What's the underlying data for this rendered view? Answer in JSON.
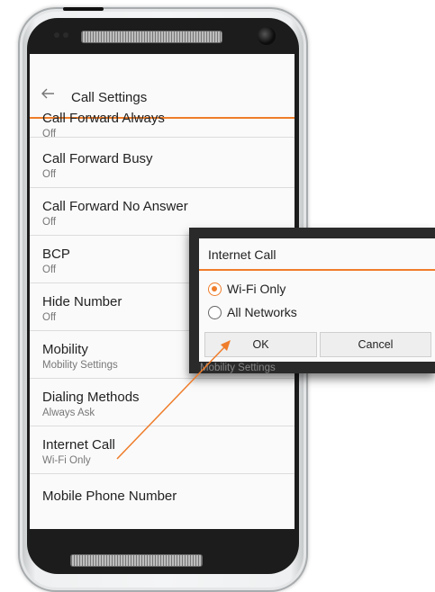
{
  "header": {
    "title": "Call Settings",
    "back_icon": "arrow-left-icon"
  },
  "settings": [
    {
      "title": "Call Forward Always",
      "value": "Off"
    },
    {
      "title": "Call Forward Busy",
      "value": "Off"
    },
    {
      "title": "Call Forward No Answer",
      "value": "Off"
    },
    {
      "title": "BCP",
      "value": "Off"
    },
    {
      "title": "Hide Number",
      "value": "Off"
    },
    {
      "title": "Mobility",
      "value": "Mobility Settings"
    },
    {
      "title": "Dialing Methods",
      "value": "Always Ask"
    },
    {
      "title": "Internet Call",
      "value": "Wi-Fi Only"
    },
    {
      "title": "Mobile Phone Number",
      "value": ""
    }
  ],
  "dialog": {
    "title": "Internet Call",
    "options": [
      {
        "label": "Wi-Fi Only",
        "selected": true
      },
      {
        "label": "All Networks",
        "selected": false
      }
    ],
    "ok_label": "OK",
    "cancel_label": "Cancel",
    "background_text": "Mobility Settings"
  },
  "colors": {
    "accent": "#ef7d2a"
  }
}
